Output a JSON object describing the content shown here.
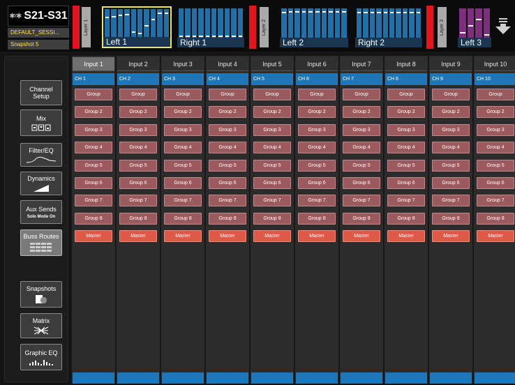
{
  "brand": {
    "logo": "✱ᵞ✱",
    "title": "S21-S31"
  },
  "session": "DEFAULT_SESSI...",
  "snapshot": "Snapshot 5",
  "layers": [
    {
      "label": "Layer 1"
    },
    {
      "label": "Layer 2"
    },
    {
      "label": "Layer 3"
    }
  ],
  "banks": [
    {
      "label": "Left 1",
      "selected": true,
      "levels": [
        0.72,
        0.76,
        0.8,
        0.82,
        0.2,
        0.15,
        0.42,
        0.65,
        0.88,
        0.88
      ]
    },
    {
      "label": "Right 1",
      "selected": false,
      "levels": [
        0.06,
        0.06,
        0.06,
        0.06,
        0.06,
        0.06,
        0.06,
        0.06,
        0.06,
        0.06
      ]
    },
    {
      "label": "Left 2",
      "selected": false,
      "levels": [
        0.88,
        0.9,
        0.9,
        0.9,
        0.9,
        0.9,
        0.9,
        0.9,
        0.9,
        0.9
      ]
    },
    {
      "label": "Right 2",
      "selected": false,
      "levels": [
        0.88,
        0.88,
        0.88,
        0.88,
        0.88,
        0.88,
        0.88,
        0.88,
        0.88,
        0.88
      ]
    },
    {
      "label": "Left 3",
      "selected": false,
      "levels": [
        0.2,
        0.42,
        0.65,
        0.12
      ]
    }
  ],
  "sidebar": [
    {
      "label": "Channel Setup",
      "sub": "",
      "icon": "none"
    },
    {
      "label": "Mix",
      "sub": "",
      "icon": "mix-icon"
    },
    {
      "label": "Filter/EQ",
      "sub": "",
      "icon": "eq-curve-icon"
    },
    {
      "label": "Dynamics",
      "sub": "",
      "icon": "dynamics-icon"
    },
    {
      "label": "Aux Sends",
      "sub": "Solo Mode On",
      "icon": "none"
    },
    {
      "label": "Buss Routes",
      "sub": "",
      "icon": "grid-icon",
      "active": true
    },
    {
      "label": "Snapshots",
      "sub": "",
      "icon": "snapshot-icon"
    },
    {
      "label": "Matrix",
      "sub": "",
      "icon": "matrix-icon"
    },
    {
      "label": "Graphic EQ",
      "sub": "",
      "icon": "graphic-eq-icon"
    }
  ],
  "channels": [
    {
      "input": "Input 1",
      "ch": "CH 1"
    },
    {
      "input": "Input 2",
      "ch": "CH 2"
    },
    {
      "input": "Input 3",
      "ch": "CH 3"
    },
    {
      "input": "Input 4",
      "ch": "CH 4"
    },
    {
      "input": "Input 5",
      "ch": "CH 5"
    },
    {
      "input": "Input 6",
      "ch": "CH 6"
    },
    {
      "input": "Input 7",
      "ch": "CH 7"
    },
    {
      "input": "Input 8",
      "ch": "CH 8"
    },
    {
      "input": "Input 9",
      "ch": "CH 9"
    },
    {
      "input": "Input 10",
      "ch": "CH 10"
    }
  ],
  "routes": [
    "Group",
    "Group 2",
    "Group 3",
    "Group 4",
    "Group 5",
    "Group 6",
    "Group 7",
    "Group 8"
  ],
  "master": "Master",
  "colors": {
    "channel_blue": "#1d76b7",
    "route": "#9b5a5d",
    "master": "#dd5a48",
    "layer_red": "#e3141b",
    "status_yellow": "#ffe63d"
  }
}
